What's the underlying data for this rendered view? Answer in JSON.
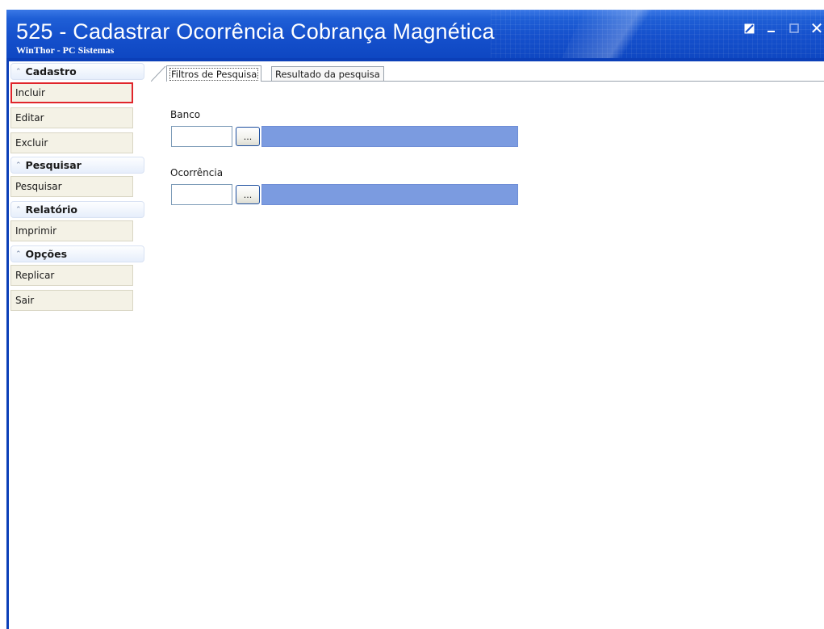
{
  "window": {
    "title": "525 - Cadastrar Ocorrência Cobrança Magnética",
    "subtitle": "WinThor - PC Sistemas",
    "controls": {
      "restore": "restore-icon",
      "minimize": "minimize-icon",
      "maximize": "maximize-icon",
      "close": "close-icon"
    }
  },
  "sidebar": {
    "groups": [
      {
        "label": "Cadastro",
        "items": [
          {
            "label": "Incluir",
            "selected": true
          },
          {
            "label": "Editar"
          },
          {
            "label": "Excluir"
          }
        ]
      },
      {
        "label": "Pesquisar",
        "items": [
          {
            "label": "Pesquisar"
          }
        ]
      },
      {
        "label": "Relatório",
        "items": [
          {
            "label": "Imprimir"
          }
        ]
      },
      {
        "label": "Opções",
        "items": [
          {
            "label": "Replicar"
          },
          {
            "label": "Sair"
          }
        ]
      }
    ]
  },
  "tabs": [
    {
      "label": "Filtros de Pesquisa",
      "active": true
    },
    {
      "label": "Resultado da pesquisa",
      "active": false
    }
  ],
  "filters": {
    "banco": {
      "label": "Banco",
      "value": "",
      "button_label": "...",
      "description": ""
    },
    "ocorrencia": {
      "label": "Ocorrência",
      "value": "",
      "button_label": "...",
      "description": ""
    }
  },
  "colors": {
    "titlebar": "#1550cc",
    "description_field": "#7b9be0",
    "selected_outline": "#e0252b",
    "sidebar_item_bg": "#f4f2e6",
    "group_header_bg": "#e6eefb"
  }
}
